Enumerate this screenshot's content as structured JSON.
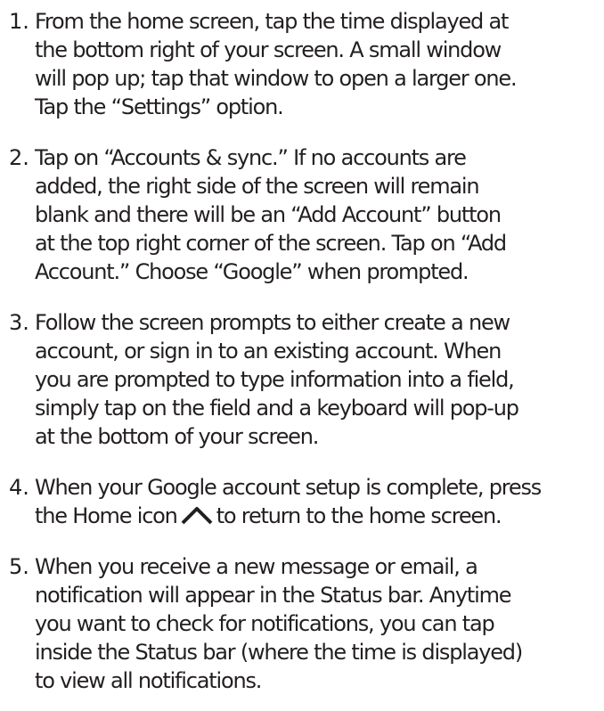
{
  "steps": [
    {
      "number": "1.",
      "lines": [
        "From the home screen, tap the time displayed at",
        "the bottom right of your screen. A small window",
        "will pop up; tap that window to open a larger one.",
        "Tap the “Settings” option."
      ]
    },
    {
      "number": "2.",
      "lines": [
        "Tap on “Accounts & sync.” If no accounts are",
        "added, the right side of the screen will remain",
        "blank and there will be an “Add Account” button",
        "at the top right corner of the screen. Tap on “Add",
        "Account.” Choose “Google” when prompted."
      ]
    },
    {
      "number": "3.",
      "lines": [
        "Follow the screen prompts to either create a new",
        "account, or sign in to an existing account. When",
        "you are prompted to type information into a field,",
        "simply tap on the field and a keyboard will pop-up",
        "at the bottom of your screen."
      ]
    },
    {
      "number": "4.",
      "line1": "When your Google account setup is complete, press",
      "line2_before_icon": "the Home icon",
      "line2_after_icon": "to return to the home screen.",
      "icon": "home-chevron-icon"
    },
    {
      "number": "5.",
      "lines": [
        "When you receive a new message or email, a",
        "notification will appear in the Status bar. Anytime",
        "you want to check for notifications, you can tap",
        "inside the Status bar (where the time is displayed)",
        "to view all notifications."
      ]
    }
  ],
  "colors": {
    "text": "#231f20",
    "background": "#ffffff"
  }
}
